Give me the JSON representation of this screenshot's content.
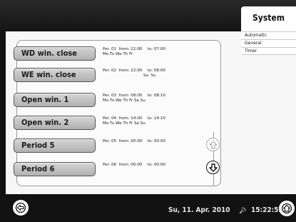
{
  "header": {
    "title": "System"
  },
  "menu": {
    "items": [
      {
        "label": "Automatic"
      },
      {
        "label": "General"
      },
      {
        "label": "Timer"
      }
    ]
  },
  "timers": [
    {
      "label": "WD win. close",
      "line1": "Per. 01  from: 22:00    to: 07:00",
      "line2": "Mo Tu We Th Fr"
    },
    {
      "label": "WE win. close",
      "line1": "Per. 02  from: 22:00    to: 08:00",
      "line2": "                                Sa  Su"
    },
    {
      "label": "Open win. 1",
      "line1": "Per. 03  from: 08:00    to: 08:10",
      "line2": "Mo Tu We Th Fr Sa Su"
    },
    {
      "label": "Open win. 2",
      "line1": "Per. 04  from: 14:00    to: 14:10",
      "line2": "Mo Tu We Th Fr Sa Su"
    },
    {
      "label": "Period 5",
      "line1": "Per. 05  from: 00:00    to: 00:00",
      "line2": ""
    },
    {
      "label": "Period 6",
      "line1": "Per. 06  from: 00:00    to: 00:00",
      "line2": ""
    }
  ],
  "footer": {
    "date": "Su, 11. Apr. 2010",
    "time": "15:22:53"
  },
  "colors": {
    "background": "#121212",
    "panel": "#f7f7f7",
    "button": "#c4c4c4"
  },
  "icons": {
    "back": "back-arrow-icon",
    "home": "home-icon",
    "scroll_up": "arrow-up-icon",
    "scroll_down": "arrow-down-icon",
    "clock_sync": "satellite-icon"
  }
}
